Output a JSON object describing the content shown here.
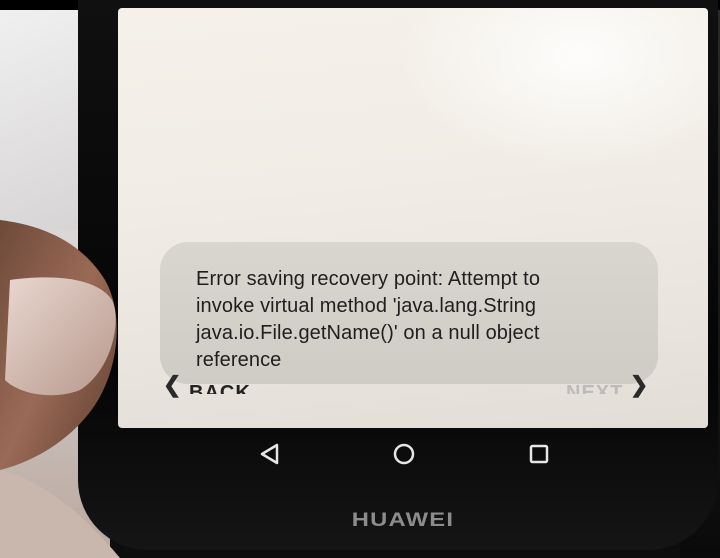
{
  "error_toast": {
    "lines": [
      "Error saving recovery point: Attempt to",
      "invoke virtual method 'java.lang.String",
      "java.io.File.getName()' on a null object",
      "reference"
    ]
  },
  "navigation": {
    "back_label": "BACK",
    "next_label": "NEXT"
  },
  "system_nav": {
    "icons": [
      "triangle-back-icon",
      "circle-home-icon",
      "square-recents-icon"
    ]
  },
  "device": {
    "brand": "HUAWEI"
  }
}
